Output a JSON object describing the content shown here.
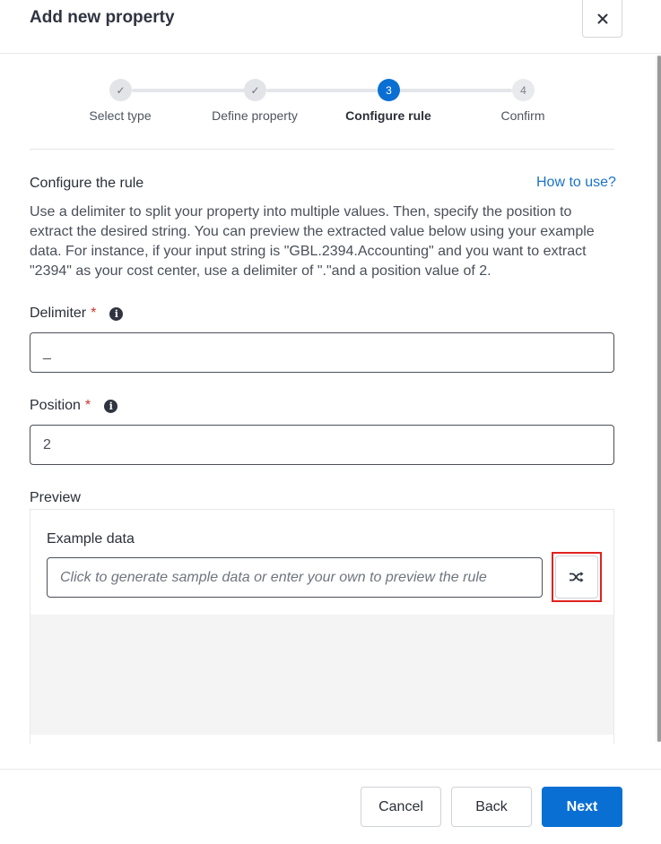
{
  "header": {
    "title": "Add new property",
    "close_icon": "close-icon"
  },
  "stepper": {
    "steps": [
      {
        "label": "Select type",
        "state": "done",
        "marker": "✓"
      },
      {
        "label": "Define property",
        "state": "done",
        "marker": "✓"
      },
      {
        "label": "Configure rule",
        "state": "active",
        "marker": "3"
      },
      {
        "label": "Confirm",
        "state": "todo",
        "marker": "4"
      }
    ]
  },
  "rule": {
    "title": "Configure the rule",
    "help_link": "How to use?",
    "description": "Use a delimiter to split your property into multiple values. Then, specify the position to extract the desired string. You can preview the extracted value below using your example data. For instance, if your input string is \"GBL.2394.Accounting\" and you want to extract \"2394\" as your cost center, use a delimiter of \".\"and a position value of 2."
  },
  "delimiter": {
    "label": "Delimiter",
    "required": "*",
    "info": "i",
    "value": "_"
  },
  "position": {
    "label": "Position",
    "required": "*",
    "info": "i",
    "value": "2"
  },
  "preview": {
    "label": "Preview",
    "example_label": "Example data",
    "example_placeholder": "Click to generate sample data or enter your own to preview the rule",
    "shuffle_icon": "shuffle-icon"
  },
  "footer": {
    "cancel": "Cancel",
    "back": "Back",
    "next": "Next"
  },
  "colors": {
    "primary": "#0a6fd3",
    "required": "#d0302b",
    "link": "#1a73c8",
    "highlight": "#e0231e"
  }
}
